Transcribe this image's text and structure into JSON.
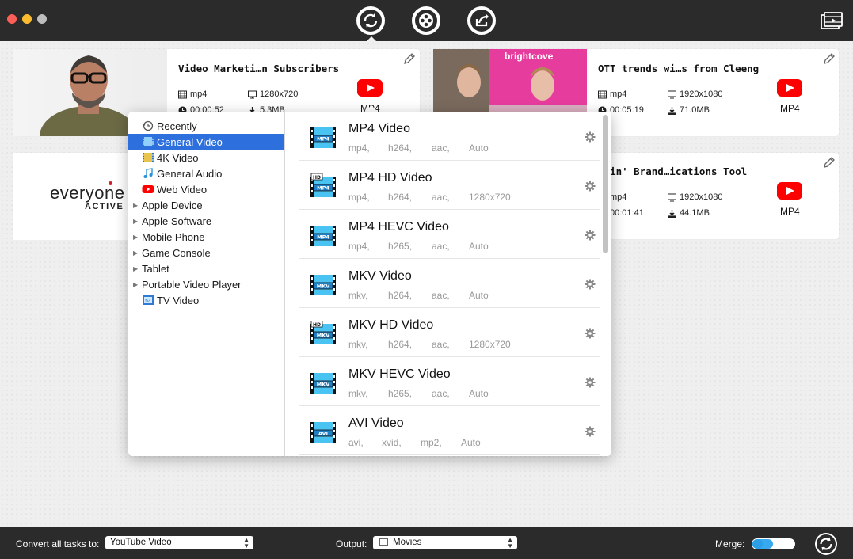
{
  "toolbar": {
    "convert_icon": "convert-icon",
    "reel_icon": "film-reel-icon",
    "share_icon": "share-icon",
    "media_icon": "media-browser-icon"
  },
  "videos": [
    {
      "title": "Video Marketi…n Subscribers",
      "format": "mp4",
      "resolution": "1280x720",
      "duration": "00:00:52",
      "size": "5.3MB",
      "target": "MP4"
    },
    {
      "title": "OTT trends wi…s from Cleeng",
      "format": "mp4",
      "resolution": "1920x1080",
      "duration": "00:05:19",
      "size": "71.0MB",
      "target": "MP4",
      "thumb_text": "brightcove"
    },
    {
      "title": "",
      "thumb_text": "everyone",
      "thumb_sub": "ACTIVE"
    },
    {
      "title": "nkin' Brand…ications Tool",
      "format": "mp4",
      "resolution": "1920x1080",
      "duration": "00:01:41",
      "size": "44.1MB",
      "target": "MP4"
    }
  ],
  "categories": [
    {
      "label": "Recently",
      "type": "icon",
      "icon": "clock-icon"
    },
    {
      "label": "General Video",
      "type": "icon",
      "icon": "film-icon",
      "selected": true
    },
    {
      "label": "4K Video",
      "type": "icon",
      "icon": "4k-film-icon"
    },
    {
      "label": "General Audio",
      "type": "icon",
      "icon": "music-note-icon"
    },
    {
      "label": "Web Video",
      "type": "icon",
      "icon": "youtube-icon"
    },
    {
      "label": "Apple Device",
      "type": "group"
    },
    {
      "label": "Apple Software",
      "type": "group"
    },
    {
      "label": "Mobile Phone",
      "type": "group"
    },
    {
      "label": "Game Console",
      "type": "group"
    },
    {
      "label": "Tablet",
      "type": "group"
    },
    {
      "label": "Portable Video Player",
      "type": "group"
    },
    {
      "label": "TV Video",
      "type": "icon",
      "icon": "tv-icon"
    }
  ],
  "formats": [
    {
      "name": "MP4 Video",
      "badge": "MP4",
      "hd": false,
      "specs": [
        "mp4,",
        "h264,",
        "aac,",
        "Auto"
      ]
    },
    {
      "name": "MP4 HD Video",
      "badge": "MP4",
      "hd": true,
      "specs": [
        "mp4,",
        "h264,",
        "aac,",
        "1280x720"
      ]
    },
    {
      "name": "MP4 HEVC Video",
      "badge": "MP4",
      "hd": false,
      "specs": [
        "mp4,",
        "h265,",
        "aac,",
        "Auto"
      ]
    },
    {
      "name": "MKV Video",
      "badge": "MKV",
      "hd": false,
      "specs": [
        "mkv,",
        "h264,",
        "aac,",
        "Auto"
      ]
    },
    {
      "name": "MKV HD Video",
      "badge": "MKV",
      "hd": true,
      "specs": [
        "mkv,",
        "h264,",
        "aac,",
        "1280x720"
      ]
    },
    {
      "name": "MKV HEVC Video",
      "badge": "MKV",
      "hd": false,
      "specs": [
        "mkv,",
        "h265,",
        "aac,",
        "Auto"
      ]
    },
    {
      "name": "AVI Video",
      "badge": "AVI",
      "hd": false,
      "specs": [
        "avi,",
        "xvid,",
        "mp2,",
        "Auto"
      ]
    }
  ],
  "bottom": {
    "convert_label": "Convert all tasks to:",
    "convert_value": "YouTube Video",
    "output_label": "Output:",
    "output_value": "Movies",
    "merge_label": "Merge:"
  },
  "colors": {
    "selection": "#2d6fdc",
    "youtube": "#ff0000",
    "bar": "#2b2b2b",
    "toggle": "#39a9ee"
  }
}
